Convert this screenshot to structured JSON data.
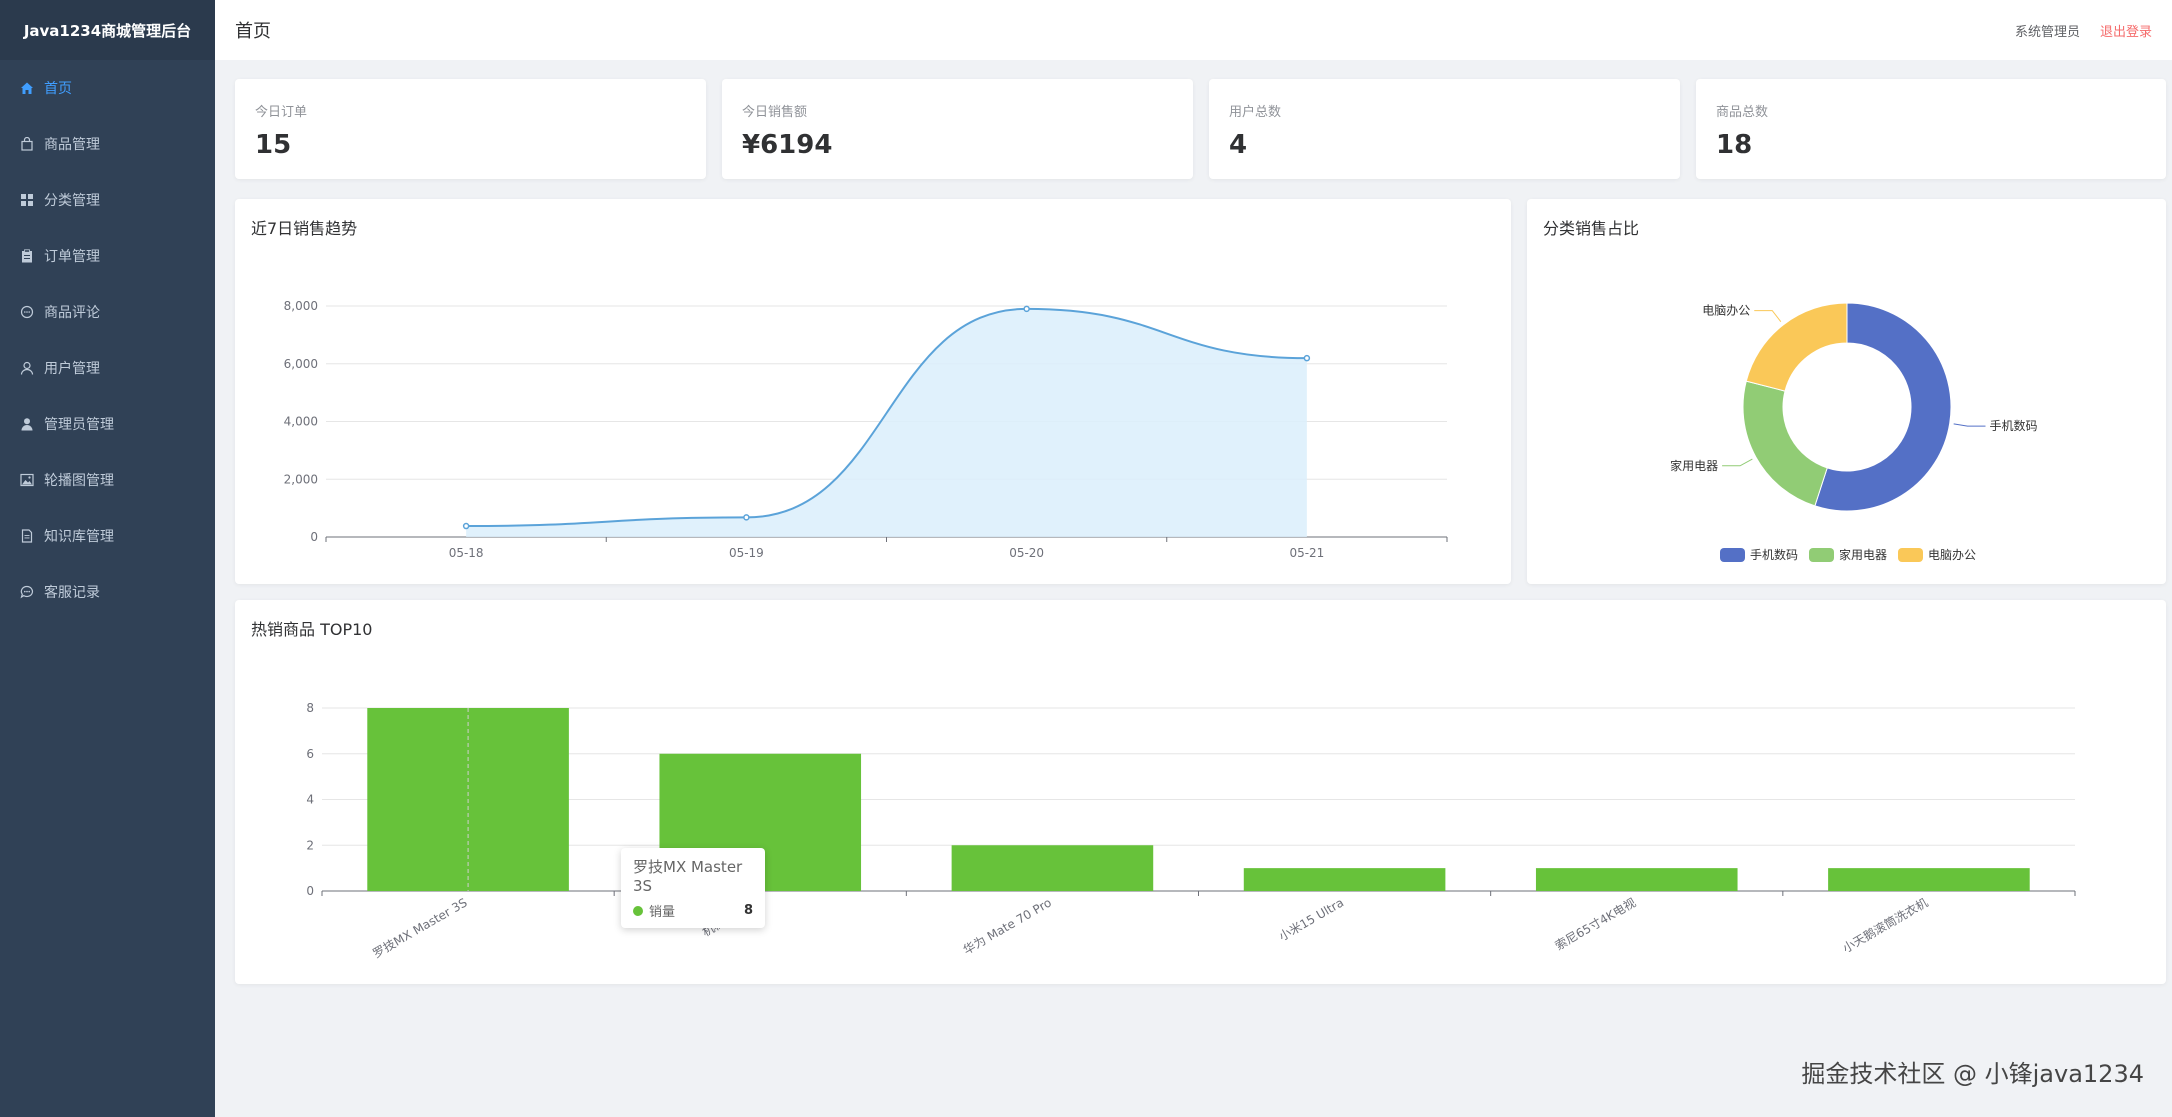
{
  "sidebar": {
    "brand": "Java1234商城管理后台",
    "items": [
      {
        "label": "首页",
        "icon": "home-icon",
        "active": true
      },
      {
        "label": "商品管理",
        "icon": "bag-icon"
      },
      {
        "label": "分类管理",
        "icon": "grid-icon"
      },
      {
        "label": "订单管理",
        "icon": "clipboard-icon"
      },
      {
        "label": "商品评论",
        "icon": "chat-icon"
      },
      {
        "label": "用户管理",
        "icon": "user-icon"
      },
      {
        "label": "管理员管理",
        "icon": "admin-icon"
      },
      {
        "label": "轮播图管理",
        "icon": "picture-icon"
      },
      {
        "label": "知识库管理",
        "icon": "document-icon"
      },
      {
        "label": "客服记录",
        "icon": "message-icon"
      }
    ]
  },
  "header": {
    "title": "首页",
    "user": "系统管理员",
    "logout": "退出登录"
  },
  "stats": [
    {
      "label": "今日订单",
      "value": "15"
    },
    {
      "label": "今日销售额",
      "value": "¥6194"
    },
    {
      "label": "用户总数",
      "value": "4"
    },
    {
      "label": "商品总数",
      "value": "18"
    }
  ],
  "panels": {
    "trend_title": "近7日销售趋势",
    "category_title": "分类销售占比",
    "top_title": "热销商品 TOP10"
  },
  "colors": {
    "accent": "#409eff",
    "line": "#5ba3d9",
    "area": "#dbeefc",
    "bar": "#67c23a",
    "pie": [
      "#5470c6",
      "#91cc75",
      "#fac858"
    ],
    "logout": "#f56c6c"
  },
  "chart_data": [
    {
      "type": "line",
      "x": [
        "05-18",
        "05-19",
        "05-20",
        "05-21"
      ],
      "values": [
        380,
        680,
        7900,
        6194
      ],
      "ylim": [
        0,
        8000
      ],
      "yticks": [
        "0",
        "2,000",
        "4,000",
        "6,000",
        "8,000"
      ],
      "grid": true
    },
    {
      "type": "pie",
      "labels": [
        "手机数码",
        "家用电器",
        "电脑办公"
      ],
      "values": [
        55,
        24,
        21
      ],
      "legend": "bottom"
    },
    {
      "type": "bar",
      "categories": [
        "罗技MX Master 3S",
        "机械键盘K8",
        "华为 Mate 70 Pro",
        "小米15 Ultra",
        "索尼65寸4K电视",
        "小天鹅滚筒洗衣机"
      ],
      "values": [
        8,
        6,
        2,
        1,
        1,
        1
      ],
      "ylim": [
        0,
        8
      ],
      "yticks": [
        "0",
        "2",
        "4",
        "6",
        "8"
      ],
      "tooltip": {
        "title": "罗技MX Master 3S",
        "series": "销量",
        "value": "8"
      }
    }
  ],
  "watermark": "掘金技术社区 @ 小锋java1234"
}
